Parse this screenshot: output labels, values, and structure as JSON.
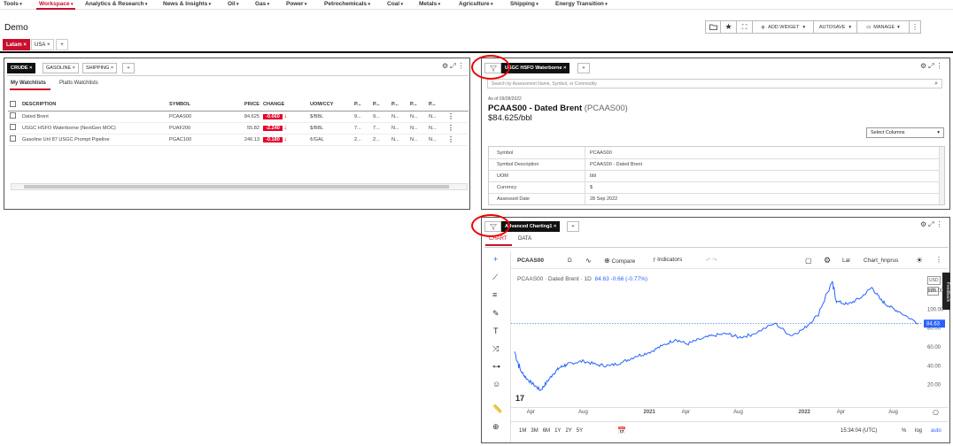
{
  "nav": {
    "items": [
      {
        "label": "Tools",
        "x": 4,
        "active": false
      },
      {
        "label": "Workspace",
        "x": 44,
        "active": true
      },
      {
        "label": "Analytics & Research",
        "x": 96,
        "active": false
      },
      {
        "label": "News & Insights",
        "x": 184,
        "active": false
      },
      {
        "label": "Oil",
        "x": 257,
        "active": false
      },
      {
        "label": "Gas",
        "x": 288,
        "active": false
      },
      {
        "label": "Power",
        "x": 323,
        "active": false
      },
      {
        "label": "Petrochemicals",
        "x": 366,
        "active": false
      },
      {
        "label": "Coal",
        "x": 437,
        "active": false
      },
      {
        "label": "Metals",
        "x": 473,
        "active": false
      },
      {
        "label": "Agriculture",
        "x": 518,
        "active": false
      },
      {
        "label": "Shipping",
        "x": 576,
        "active": false
      },
      {
        "label": "Energy Transition",
        "x": 627,
        "active": false
      }
    ]
  },
  "page": {
    "title": "Demo"
  },
  "toolbar": {
    "add_widget": "ADD WIDGET",
    "autosave": "AUTOSAVE",
    "manage": "MANAGE"
  },
  "ws_tabs": [
    {
      "label": "Latam",
      "active": true
    },
    {
      "label": "USA",
      "active": false
    }
  ],
  "watchlist": {
    "tabs": [
      {
        "label": "CRUDE",
        "active": true
      },
      {
        "label": "GASOLINE",
        "active": false
      },
      {
        "label": "SHIPPING",
        "active": false
      }
    ],
    "subtabs": [
      "My Watchlists",
      "Platts Watchlists"
    ],
    "columns": [
      "DESCRIPTION",
      "SYMBOL",
      "PRICE",
      "CHANGE",
      "UOM/CCY",
      "P...",
      "P...",
      "P...",
      "P...",
      "P..."
    ],
    "rows": [
      {
        "desc": "Dated Brent",
        "symbol": "PCAAS00",
        "price": "84.625",
        "change": "-0.660",
        "uom": "$/BBL",
        "p1": "9...",
        "p2": "9...",
        "p3": "N...",
        "p4": "N...",
        "p5": "N..."
      },
      {
        "desc": "USGC HSFO Waterborne (NextGen MOC)",
        "symbol": "PUAF200",
        "price": "55.82",
        "change": "-2.240",
        "uom": "$/BBL",
        "p1": "7...",
        "p2": "7...",
        "p3": "N...",
        "p4": "N...",
        "p5": "N..."
      },
      {
        "desc": "Gasoline Unl 87 USGC Prompt Pipeline",
        "symbol": "PGAC100",
        "price": "246.13",
        "change": "-0.180",
        "uom": "¢/GAL",
        "p1": "2...",
        "p2": "2...",
        "p3": "N...",
        "p4": "N...",
        "p5": "N..."
      }
    ]
  },
  "detail": {
    "tab": "USGC HSFO Waterborne",
    "search_placeholder": "Search by Assessment Name, Symbol, or Commodity",
    "as_of": "As of 09/28/2022",
    "title_main": "PCAAS00 - Dated Brent",
    "title_sub": "(PCAAS00)",
    "price": "$84.625/bbl",
    "select_columns": "Select Columns",
    "rows": [
      {
        "k": "Symbol",
        "v": "PCAAS00"
      },
      {
        "k": "Symbol Description",
        "v": "PCAAS00 - Dated Brent"
      },
      {
        "k": "UOM",
        "v": "bbl"
      },
      {
        "k": "Currency",
        "v": "$"
      },
      {
        "k": "Assessed Date",
        "v": "28 Sep 2022"
      }
    ]
  },
  "charting": {
    "tab": "Advanced Charting1",
    "subtabs": [
      "CHART",
      "DATA"
    ],
    "symbol": "PCAAS00",
    "interval": "D",
    "compare": "Compare",
    "indicators": "Indicators",
    "layout_name": "Chart_hnprus",
    "legend": "PCAAS00 · Dated Brent · 1D",
    "legend_vals": "84.63  -0.66 (-0.77%)",
    "last_price": "84.63",
    "currency_badge": "USD",
    "unit_badge": "BBL",
    "feedback": "Feedback",
    "ranges": [
      "1M",
      "3M",
      "6M",
      "1Y",
      "2Y",
      "5Y"
    ],
    "time": "15:34:04 (UTC)",
    "pct": "%",
    "log": "log",
    "auto": "auto",
    "xaxis": [
      "Apr",
      "Aug",
      "2021",
      "Apr",
      "Aug",
      "2022",
      "Apr",
      "Aug"
    ],
    "yaxis": [
      "20.00",
      "40.00",
      "60.00",
      "80.00",
      "100.00",
      "120.00"
    ],
    "colors": {
      "line": "#2962ff",
      "badge": "#2962ff"
    }
  },
  "chart_data": {
    "type": "line",
    "title": "PCAAS00 · Dated Brent · 1D",
    "x_ticks": [
      "Apr",
      "Aug",
      "2021",
      "Apr",
      "Aug",
      "2022",
      "Apr",
      "Aug"
    ],
    "y_ticks": [
      20,
      40,
      60,
      80,
      100,
      120
    ],
    "ylim": [
      0,
      135
    ],
    "series": [
      {
        "name": "PCAAS00 · Dated Brent · 1D",
        "x": [
          "2020-02-20",
          "2020-03-05",
          "2020-03-20",
          "2020-04-05",
          "2020-04-21",
          "2020-05-05",
          "2020-05-20",
          "2020-06-05",
          "2020-06-20",
          "2020-07-05",
          "2020-08-01",
          "2020-09-01",
          "2020-10-01",
          "2020-11-01",
          "2020-12-01",
          "2021-01-01",
          "2021-02-01",
          "2021-03-05",
          "2021-04-01",
          "2021-05-01",
          "2021-06-01",
          "2021-07-05",
          "2021-08-01",
          "2021-09-01",
          "2021-10-25",
          "2021-12-01",
          "2022-01-01",
          "2022-02-01",
          "2022-03-08",
          "2022-03-20",
          "2022-04-15",
          "2022-05-15",
          "2022-06-10",
          "2022-07-01",
          "2022-07-20",
          "2022-08-15",
          "2022-09-28"
        ],
        "y": [
          55,
          35,
          26,
          20,
          14,
          22,
          31,
          38,
          41,
          43,
          45,
          41,
          40,
          44,
          50,
          54,
          61,
          68,
          63,
          68,
          72,
          74,
          70,
          73,
          85,
          72,
          79,
          93,
          128,
          108,
          105,
          112,
          123,
          110,
          103,
          97,
          84.63
        ]
      }
    ]
  }
}
